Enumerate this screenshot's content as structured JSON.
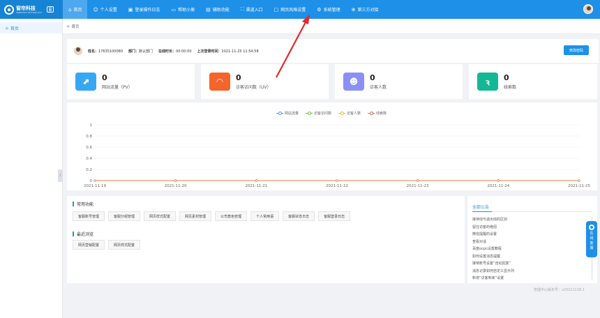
{
  "brand": {
    "name": "窗帘科技",
    "sub": "WINDOWS TECHNOLOGY"
  },
  "nav": [
    {
      "label": "首页",
      "icon": "⌂",
      "active": true
    },
    {
      "label": "个人设置",
      "icon": "☺"
    },
    {
      "label": "登录操作日志",
      "icon": "▣"
    },
    {
      "label": "帮助小册",
      "icon": "▭"
    },
    {
      "label": "辅助功能",
      "icon": "▤"
    },
    {
      "label": "渠道入口",
      "icon": "⛶"
    },
    {
      "label": "网页风格设置",
      "icon": "▢"
    },
    {
      "label": "系统管理",
      "icon": "⚙"
    },
    {
      "label": "第三方对接",
      "icon": "⊕"
    }
  ],
  "sidebar": {
    "items": [
      {
        "label": "首页",
        "icon": "⌂"
      }
    ]
  },
  "breadcrumb": {
    "label": "首页"
  },
  "user": {
    "name_label": "姓名：",
    "name": "17635100080",
    "dept_label": "部门：",
    "dept": "默认部门",
    "online_label": "在线时长：",
    "online": "00:00:00",
    "last_label": "上次登录时间：",
    "last": "2021-11-25 11:54:58",
    "pwd_button": "修改密码"
  },
  "stats": [
    {
      "value": "0",
      "label": "网站流量（PV）",
      "color": "#36a7f5",
      "icon": "📈"
    },
    {
      "value": "0",
      "label": "访客访问数（UV）",
      "color": "#f4642b",
      "icon": "ϑ"
    },
    {
      "value": "0",
      "label": "访客人数",
      "color": "#8b90f7",
      "icon": "☻"
    },
    {
      "value": "0",
      "label": "线索数",
      "color": "#14b894",
      "icon": "Ꝛ"
    }
  ],
  "chart_data": {
    "type": "line",
    "categories": [
      "2021-11-19",
      "2021-11-20",
      "2021-11-21",
      "2021-11-22",
      "2021-11-23",
      "2021-11-24",
      "2021-11-25"
    ],
    "series": [
      {
        "name": "网站流量",
        "values": [
          0,
          0,
          0,
          0,
          0,
          0,
          0
        ],
        "color": "#5b8ff9"
      },
      {
        "name": "访客访问数",
        "values": [
          0,
          0,
          0,
          0,
          0,
          0,
          0
        ],
        "color": "#67c23a"
      },
      {
        "name": "访客人数",
        "values": [
          0,
          0,
          0,
          0,
          0,
          0,
          0
        ],
        "color": "#f6bd16"
      },
      {
        "name": "线索数",
        "values": [
          0,
          0,
          0,
          0,
          0,
          0,
          0
        ],
        "color": "#e8684a"
      }
    ],
    "yticks": [
      "0",
      "0.2",
      "0.4",
      "0.6",
      "0.8",
      "1"
    ],
    "ylim": [
      0,
      1
    ],
    "legend": "top-center"
  },
  "functions": {
    "title": "常用功能",
    "buttons": [
      "客服账号管理",
      "客服分组管理",
      "网页样式配置",
      "网页素材管理",
      "公司角色管理",
      "个人常用语",
      "客服状态日志",
      "客服登录日志"
    ]
  },
  "recent": {
    "title": "最近浏览",
    "buttons": [
      "网页营销配置",
      "网页样式配置"
    ]
  },
  "notices": {
    "title": "全部公告",
    "items": [
      "接待线与退出线的区别",
      "留住访客的绝招",
      "微信提醒的设置",
      "查看对话",
      "百度ocpc设置教程",
      "如何设置消息提醒",
      "接待账号设置“自动回复”",
      "消息记录如何自定义显示列",
      "新增“访客到来”设置"
    ]
  },
  "online_service": {
    "label": "在线客服"
  },
  "footer": {
    "text": "管理中心版本号：v20211118.1"
  }
}
